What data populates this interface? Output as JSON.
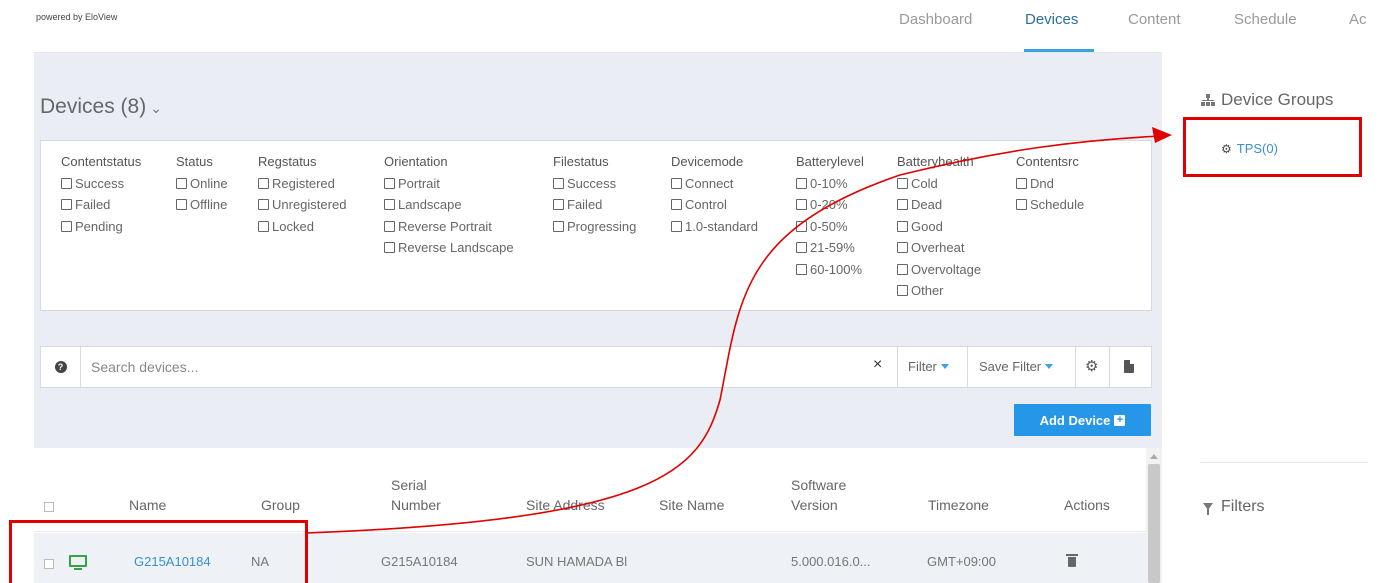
{
  "brand": {
    "powered_by": "powered by EloView"
  },
  "nav": {
    "items": [
      {
        "label": "Dashboard",
        "active": false
      },
      {
        "label": "Devices",
        "active": true
      },
      {
        "label": "Content",
        "active": false
      },
      {
        "label": "Schedule",
        "active": false
      },
      {
        "label": "Ac",
        "active": false
      }
    ]
  },
  "devices": {
    "title": "Devices (8)",
    "chevron_icon": "chevron-down-icon"
  },
  "filters": {
    "groups": [
      {
        "header": "Contentstatus",
        "options": [
          "Success",
          "Failed",
          "Pending"
        ]
      },
      {
        "header": "Status",
        "options": [
          "Online",
          "Offline"
        ]
      },
      {
        "header": "Regstatus",
        "options": [
          "Registered",
          "Unregistered",
          "Locked"
        ]
      },
      {
        "header": "Orientation",
        "options": [
          "Portrait",
          "Landscape",
          "Reverse Portrait",
          "Reverse Landscape"
        ]
      },
      {
        "header": "Filestatus",
        "options": [
          "Success",
          "Failed",
          "Progressing"
        ]
      },
      {
        "header": "Devicemode",
        "options": [
          "Connect",
          "Control",
          "1.0-standard"
        ]
      },
      {
        "header": "Batterylevel",
        "options": [
          "0-10%",
          "0-20%",
          "0-50%",
          "21-59%",
          "60-100%"
        ]
      },
      {
        "header": "Batteryhealth",
        "options": [
          "Cold",
          "Dead",
          "Good",
          "Overheat",
          "Overvoltage",
          "Other"
        ]
      },
      {
        "header": "Contentsrc",
        "options": [
          "Dnd",
          "Schedule"
        ]
      }
    ]
  },
  "search": {
    "placeholder": "Search devices...",
    "filter_label": "Filter",
    "save_filter_label": "Save Filter"
  },
  "add_device": {
    "label": "Add Device"
  },
  "table": {
    "headers": {
      "name": "Name",
      "group": "Group",
      "serial_1": "Serial",
      "serial_2": "Number",
      "site_address": "Site Address",
      "site_name": "Site Name",
      "software_1": "Software",
      "software_2": "Version",
      "timezone": "Timezone",
      "actions": "Actions"
    },
    "rows": [
      {
        "name": "G215A10184",
        "group": "NA",
        "serial": "G215A10184",
        "site_address": "SUN HAMADA Bl",
        "site_name": "",
        "software": "5.000.016.0...",
        "timezone": "GMT+09:00"
      }
    ]
  },
  "sidebar": {
    "device_groups_title": "Device Groups",
    "groups": [
      {
        "label": "TPS(0)"
      }
    ],
    "filters_title": "Filters"
  },
  "colors": {
    "accent": "#3aa3e3",
    "button": "#2596e8",
    "link": "#3a8fd0",
    "annotation": "#e00000",
    "device_online": "#35a24a"
  }
}
